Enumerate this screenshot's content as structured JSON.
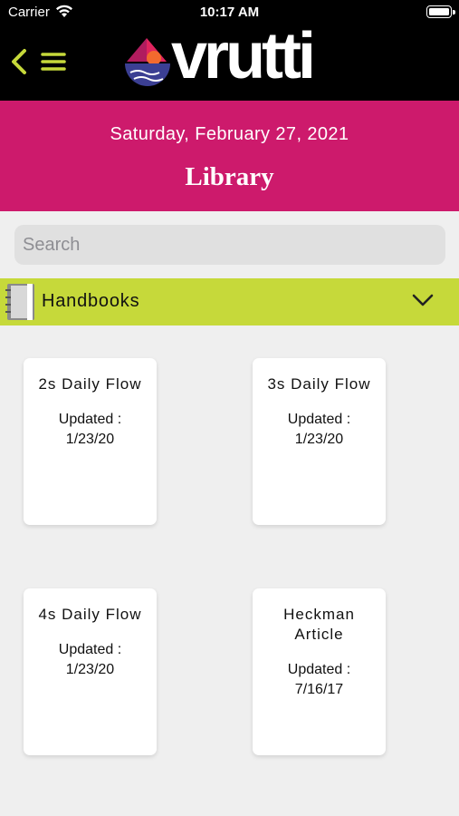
{
  "status_bar": {
    "carrier": "Carrier",
    "time": "10:17 AM"
  },
  "nav": {
    "logo_text": "vrutti",
    "accent": "#c6d93a"
  },
  "header": {
    "date": "Saturday, February 27, 2021",
    "title": "Library",
    "color": "#cd1a6c"
  },
  "search": {
    "placeholder": "Search",
    "value": ""
  },
  "category": {
    "label": "Handbooks",
    "color": "#c6d93a"
  },
  "cards": [
    {
      "name": "2s Daily Flow",
      "updated_label": "Updated :",
      "updated_date": "1/23/20"
    },
    {
      "name": "3s Daily Flow",
      "updated_label": "Updated :",
      "updated_date": "1/23/20"
    },
    {
      "name": "4s Daily Flow",
      "updated_label": "Updated :",
      "updated_date": "1/23/20"
    },
    {
      "name": "Heckman Article",
      "updated_label": "Updated :",
      "updated_date": "7/16/17"
    }
  ]
}
